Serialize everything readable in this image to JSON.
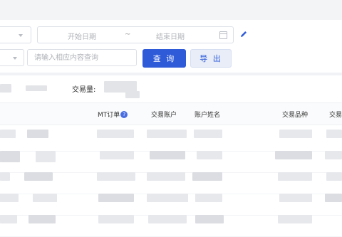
{
  "filters": {
    "date_range": {
      "start_placeholder": "开始日期",
      "separator": "~",
      "end_placeholder": "结束日期"
    },
    "search_placeholder": "请输入相应内容查询",
    "query_button": "查 询",
    "export_button": "导 出"
  },
  "summary": {
    "volume_label": "交易量:"
  },
  "table": {
    "columns": [
      "MT订单",
      "交易账户",
      "账户姓名",
      "交易品种",
      "交易"
    ],
    "visible_rows": 5
  },
  "colors": {
    "primary": "#2f5bd9",
    "export_bg": "#e8edf8",
    "help_icon": "#4a6ee0",
    "pencil_icon": "#2f5bd9"
  },
  "icons": [
    "chevron-down-icon",
    "calendar-icon",
    "pencil-icon",
    "help-icon"
  ]
}
